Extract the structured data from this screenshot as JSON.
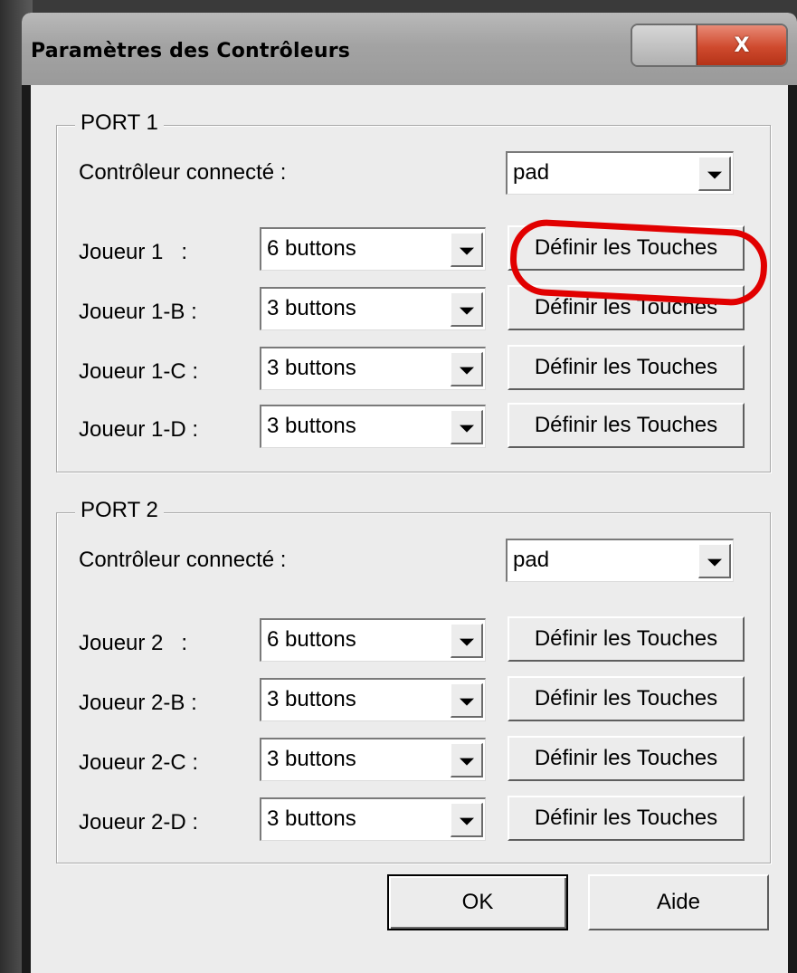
{
  "window": {
    "title": "Paramètres des Contrôleurs",
    "close_glyph": "X"
  },
  "ports": [
    {
      "title": "PORT 1",
      "controller_label": "Contrôleur connecté :",
      "controller_value": "pad",
      "players": [
        {
          "label": "Joueur 1   :",
          "type": "6 buttons",
          "button": "Définir les Touches"
        },
        {
          "label": "Joueur 1-B :",
          "type": "3 buttons",
          "button": "Définir les Touches"
        },
        {
          "label": "Joueur 1-C :",
          "type": "3 buttons",
          "button": "Définir les Touches"
        },
        {
          "label": "Joueur 1-D :",
          "type": "3 buttons",
          "button": "Définir les Touches"
        }
      ]
    },
    {
      "title": "PORT 2",
      "controller_label": "Contrôleur connecté :",
      "controller_value": "pad",
      "players": [
        {
          "label": "Joueur 2   :",
          "type": "6 buttons",
          "button": "Définir les Touches"
        },
        {
          "label": "Joueur 2-B :",
          "type": "3 buttons",
          "button": "Définir les Touches"
        },
        {
          "label": "Joueur 2-C :",
          "type": "3 buttons",
          "button": "Définir les Touches"
        },
        {
          "label": "Joueur 2-D :",
          "type": "3 buttons",
          "button": "Définir les Touches"
        }
      ]
    }
  ],
  "footer": {
    "ok_label": "OK",
    "help_label": "Aide"
  },
  "annotation": {
    "highlight_color": "#e10000"
  }
}
